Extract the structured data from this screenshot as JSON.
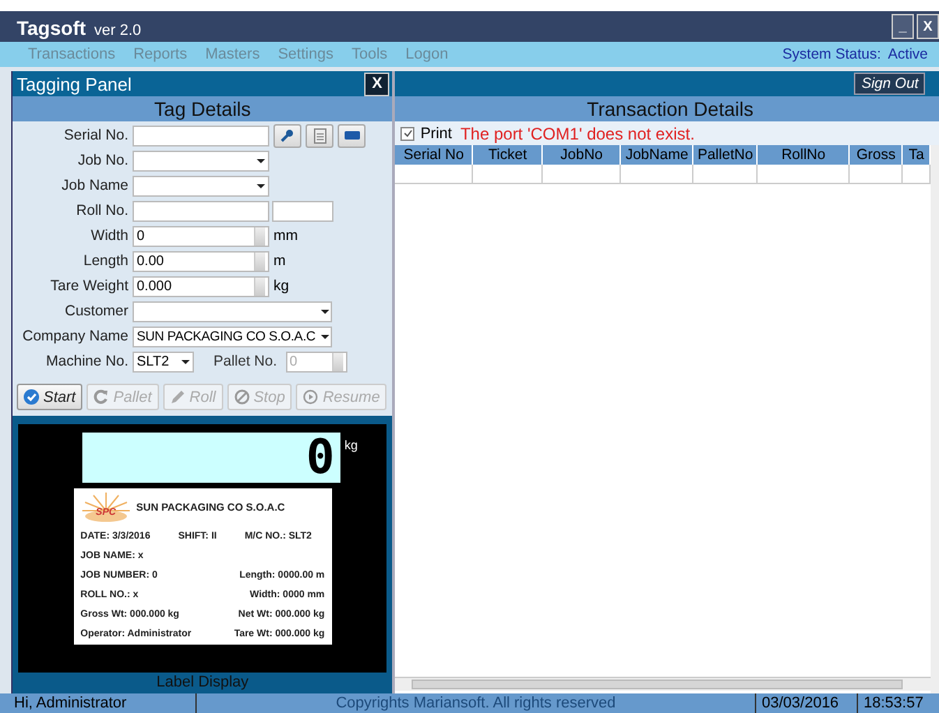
{
  "window": {
    "title": "Tagsoft",
    "version": "ver 2.0",
    "controls": [
      "_",
      "X"
    ]
  },
  "menu": [
    "Transactions",
    "Reports",
    "Masters",
    "Settings",
    "Tools",
    "Logon"
  ],
  "system_status": {
    "label": "System Status:",
    "value": "Active"
  },
  "tagging_panel": {
    "title": "Tagging Panel",
    "close": "X",
    "heading": "Tag Details",
    "fields": [
      {
        "kind": "text",
        "label": "Serial No."
      },
      {
        "kind": "combo",
        "label": "Job No."
      },
      {
        "kind": "combo",
        "label": "Job Name"
      },
      {
        "kind": "pair",
        "label": "Roll No."
      },
      {
        "kind": "spin",
        "label": "Width",
        "value": "0",
        "unit": "mm"
      },
      {
        "kind": "spin",
        "label": "Length",
        "value": "0.00",
        "unit": "m"
      },
      {
        "kind": "spin",
        "label": "Tare Weight",
        "value": "0.000",
        "unit": "kg"
      },
      {
        "kind": "wide",
        "label": "Customer"
      },
      {
        "kind": "wide",
        "label": "Company Name",
        "value": "SUN PACKAGING CO S.O.A.C"
      }
    ],
    "machine": {
      "label": "Machine No.",
      "value": "SLT2"
    },
    "pallet": {
      "label": "Pallet No.",
      "value": "0",
      "disabled": true
    },
    "buttons": [
      {
        "label": "Start",
        "disabled": false
      },
      {
        "label": "Pallet",
        "disabled": true
      },
      {
        "label": "Roll",
        "disabled": true
      },
      {
        "label": "Stop",
        "disabled": true
      },
      {
        "label": "Resume",
        "disabled": true
      }
    ]
  },
  "label_display": {
    "title": "Label Display",
    "reading": "0",
    "unit": "kg",
    "label": {
      "logo": "SPC",
      "company": "SUN PACKAGING CO S.O.A.C",
      "header": [
        "DATE: 3/3/2016",
        "SHIFT: II",
        "M/C NO.: SLT2"
      ],
      "rows": [
        {
          "left": "JOB NAME: x"
        },
        {
          "left": "JOB NUMBER: 0",
          "right": "Length: 0000.00 m"
        },
        {
          "left": "ROLL NO.: x",
          "right": "Width: 0000 mm"
        },
        {
          "left": "Gross Wt: 000.000 kg",
          "right": "Net Wt: 000.000 kg"
        },
        {
          "left": "Operator: Administrator",
          "right": "Tare Wt: 000.000 kg"
        }
      ]
    }
  },
  "transaction_panel": {
    "sign_out": "Sign Out",
    "heading": "Transaction Details",
    "print": {
      "label": "Print",
      "checked": true
    },
    "error": "The port 'COM1' does not exist.",
    "table": {
      "columns": [
        "Serial No",
        "Ticket",
        "JobNo",
        "JobName",
        "PalletNo",
        "RollNo",
        "Gross",
        "Ta"
      ]
    }
  },
  "status_bar": {
    "user": "Hi, Administrator",
    "copyright": "Copyrights Mariansoft. All rights reserved",
    "date": "03/03/2016",
    "time": "18:53:57"
  }
}
